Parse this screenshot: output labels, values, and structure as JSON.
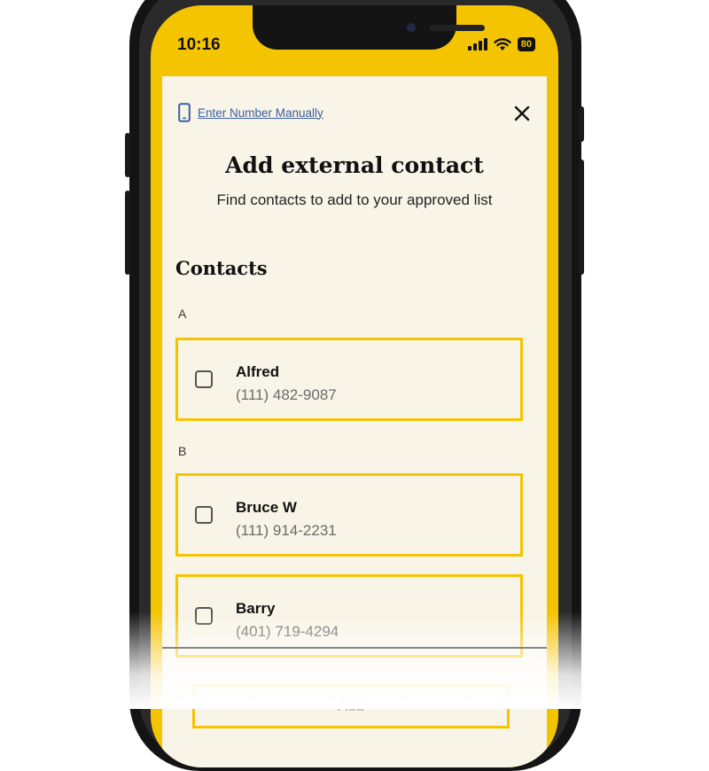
{
  "status_bar": {
    "time": "10:16",
    "battery_level": "80",
    "icons": [
      "signal-icon",
      "wifi-icon",
      "battery-icon"
    ]
  },
  "header": {
    "manual_link": "Enter Number Manually",
    "manual_icon": "phone-icon",
    "close_icon": "close-icon",
    "title": "Add external contact",
    "subtitle": "Find contacts to add to your approved list"
  },
  "contacts": {
    "section_title": "Contacts",
    "groups": [
      {
        "letter": "A",
        "items": [
          {
            "name": "Alfred",
            "phone": "(111) 482-9087",
            "checked": false
          }
        ]
      },
      {
        "letter": "B",
        "items": [
          {
            "name": "Bruce W",
            "phone": "(111) 914-2231",
            "checked": false
          },
          {
            "name": "Barry",
            "phone": "(401) 719-4294",
            "checked": false
          }
        ]
      }
    ]
  },
  "footer": {
    "add_label": "Add"
  },
  "colors": {
    "accent": "#f5c400",
    "sheet_background": "#f8f4e7",
    "link": "#3a5ea3",
    "muted_text": "#6b6b6b"
  }
}
